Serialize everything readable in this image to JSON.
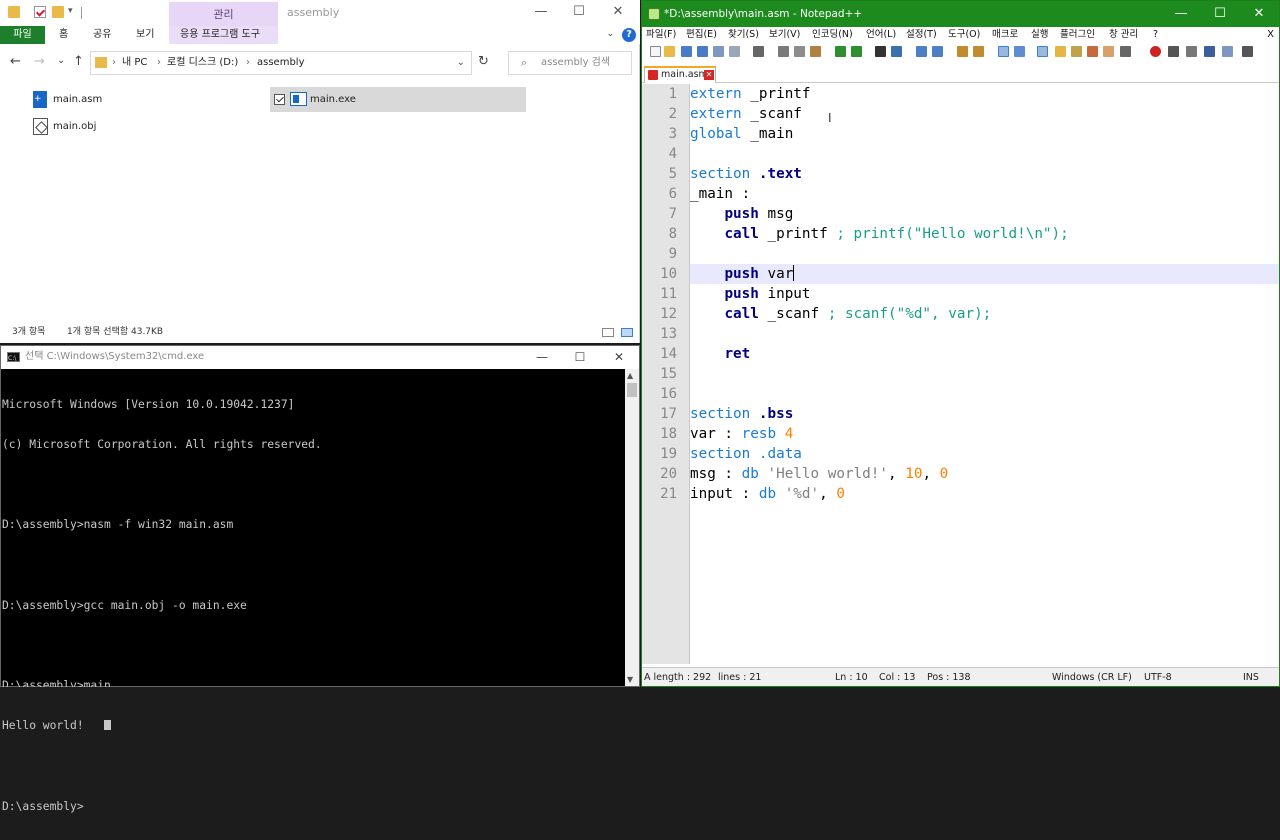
{
  "explorer": {
    "context_tab": "관리",
    "folder_name": "assembly",
    "window_controls": [
      "—",
      "☐",
      "✕"
    ],
    "ribbon_tabs": [
      "파일",
      "홈",
      "공유",
      "보기",
      "응용 프로그램 도구"
    ],
    "help_glyph": "?",
    "nav": {
      "back": "←",
      "forward": "→",
      "recent": "⌄",
      "up": "↑",
      "refresh": "↻"
    },
    "breadcrumbs": [
      "내 PC",
      "로컬 디스크 (D:)",
      "assembly"
    ],
    "breadcrumb_sep": "›",
    "search_placeholder": "assembly 검색",
    "files": [
      {
        "name": "main.asm",
        "icon": "asm-file-icon"
      },
      {
        "name": "main.obj",
        "icon": "obj-file-icon"
      },
      {
        "name": "main.exe",
        "icon": "exe-file-icon",
        "selected": true
      }
    ],
    "status": {
      "item_count": "3개 항목",
      "selection": "1개 항목 선택함 43.7KB"
    }
  },
  "cmd": {
    "title": "선택 C:\\Windows\\System32\\cmd.exe",
    "lines": [
      "Microsoft Windows [Version 10.0.19042.1237]",
      "(c) Microsoft Corporation. All rights reserved.",
      "",
      "D:\\assembly>nasm -f win32 main.asm",
      "",
      "D:\\assembly>gcc main.obj -o main.exe",
      "",
      "D:\\assembly>main",
      "Hello world!   ",
      "",
      "D:\\assembly>"
    ]
  },
  "npp": {
    "title": "*D:\\assembly\\main.asm - Notepad++",
    "menu": [
      "파일(F)",
      "편집(E)",
      "찾기(S)",
      "보기(V)",
      "인코딩(N)",
      "언어(L)",
      "설정(T)",
      "도구(O)",
      "매크로",
      "실행",
      "플러그인",
      "창 관리",
      "?"
    ],
    "menu_close": "X",
    "tab_label": "main.asm",
    "code": [
      [
        [
          "kw",
          "extern"
        ],
        [
          "id",
          " _printf"
        ]
      ],
      [
        [
          "kw",
          "extern"
        ],
        [
          "id",
          " _scanf"
        ]
      ],
      [
        [
          "kw",
          "global"
        ],
        [
          "id",
          " _main"
        ]
      ],
      [],
      [
        [
          "kw",
          "section"
        ],
        [
          "id",
          " "
        ],
        [
          "ins",
          ".text"
        ]
      ],
      [
        [
          "id",
          "_main :"
        ]
      ],
      [
        [
          "id",
          "    "
        ],
        [
          "ins",
          "push"
        ],
        [
          "id",
          " msg"
        ]
      ],
      [
        [
          "id",
          "    "
        ],
        [
          "ins",
          "call"
        ],
        [
          "id",
          " _printf "
        ],
        [
          "cm",
          "; printf(\"Hello world!\\n\");"
        ]
      ],
      [],
      [
        [
          "id",
          "    "
        ],
        [
          "ins",
          "push"
        ],
        [
          "id",
          " var"
        ]
      ],
      [
        [
          "id",
          "    "
        ],
        [
          "ins",
          "push"
        ],
        [
          "id",
          " input"
        ]
      ],
      [
        [
          "id",
          "    "
        ],
        [
          "ins",
          "call"
        ],
        [
          "id",
          " _scanf "
        ],
        [
          "cm",
          "; scanf(\"%d\", var);"
        ]
      ],
      [],
      [
        [
          "id",
          "    "
        ],
        [
          "ins",
          "ret"
        ]
      ],
      [],
      [],
      [
        [
          "kw",
          "section"
        ],
        [
          "id",
          " "
        ],
        [
          "ins",
          ".bss"
        ]
      ],
      [
        [
          "id",
          "var : "
        ],
        [
          "kw",
          "resb"
        ],
        [
          "id",
          " "
        ],
        [
          "num",
          "4"
        ]
      ],
      [
        [
          "kw",
          "section"
        ],
        [
          "id",
          " "
        ],
        [
          "kw",
          ".data"
        ]
      ],
      [
        [
          "id",
          "msg : "
        ],
        [
          "kw",
          "db"
        ],
        [
          "id",
          " "
        ],
        [
          "str",
          "'Hello world!'"
        ],
        [
          "id",
          ", "
        ],
        [
          "num",
          "10"
        ],
        [
          "id",
          ", "
        ],
        [
          "num",
          "0"
        ]
      ],
      [
        [
          "id",
          "input : "
        ],
        [
          "kw",
          "db"
        ],
        [
          "id",
          " "
        ],
        [
          "str",
          "'%d'"
        ],
        [
          "id",
          ", "
        ],
        [
          "num",
          "0"
        ]
      ]
    ],
    "current_line": 10,
    "status": {
      "length": "A length : 292",
      "lines": "lines : 21",
      "ln": "Ln : 10",
      "col": "Col : 13",
      "pos": "Pos : 138",
      "eol": "Windows (CR LF)",
      "encoding": "UTF-8",
      "mode": "INS"
    }
  }
}
